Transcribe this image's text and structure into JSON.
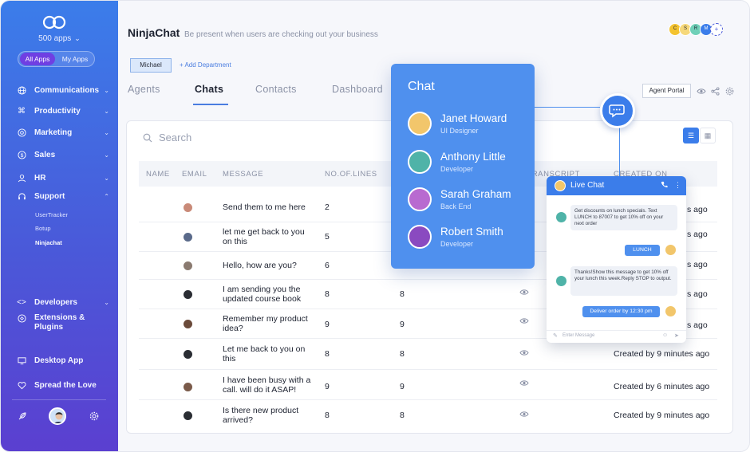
{
  "sidebar": {
    "apps_count": "500 apps",
    "pills": {
      "all": "All Apps",
      "mine": "My Apps"
    },
    "nav": [
      {
        "label": "Communications",
        "icon": "globe-icon"
      },
      {
        "label": "Productivity",
        "icon": "command-icon"
      },
      {
        "label": "Marketing",
        "icon": "megaphone-icon"
      },
      {
        "label": "Sales",
        "icon": "dollar-icon"
      },
      {
        "label": "HR",
        "icon": "person-icon"
      },
      {
        "label": "Support",
        "icon": "headset-icon"
      }
    ],
    "support_sub": [
      "UserTracker",
      "Botup",
      "Ninjachat"
    ],
    "nav2": [
      {
        "label": "Developers",
        "icon": "code-icon"
      },
      {
        "label": "Extensions & Plugins",
        "icon": "puzzle-icon"
      },
      {
        "label": "Desktop App",
        "icon": "monitor-icon"
      },
      {
        "label": "Spread the Love",
        "icon": "heart-icon"
      }
    ]
  },
  "header": {
    "title": "NinjaChat",
    "subtitle": "Be present when users are checking out your business",
    "team_initials": [
      "C",
      "S",
      "R",
      "M"
    ],
    "team_colors": [
      "#f4c32f",
      "#f6d87a",
      "#6fd0b8",
      "#3b7dea"
    ]
  },
  "department": {
    "current": "Michael",
    "add_label": "+ Add Department"
  },
  "tabs": [
    "Agents",
    "Chats",
    "Contacts",
    "Dashboard"
  ],
  "active_tab": "Chats",
  "toolbar": {
    "agent_portal": "Agent Portal"
  },
  "search": {
    "placeholder": "Search"
  },
  "table": {
    "columns": [
      "NAME",
      "EMAIL",
      "MESSAGE",
      "NO.OF.LINES",
      "T TRANSCRIPT",
      "CREATED ON"
    ],
    "rows": [
      {
        "message": "Send them to me here",
        "lines": "2",
        "count": "",
        "created": "",
        "avatar": "#c98a78"
      },
      {
        "message": "let me get back to you on this",
        "lines": "5",
        "count": "",
        "created": "",
        "avatar": "#5a6a8a"
      },
      {
        "message": "Hello, how are you?",
        "lines": "6",
        "count": "",
        "created": "",
        "avatar": "#8a7a70"
      },
      {
        "message": "I am sending you the updated course book",
        "lines": "8",
        "count": "8",
        "created": "",
        "avatar": "#2a2d33"
      },
      {
        "message": "Remember my product idea?",
        "lines": "9",
        "count": "9",
        "created": "",
        "avatar": "#6a4a3a"
      },
      {
        "message": "Let me back to you on this",
        "lines": "8",
        "count": "8",
        "created": "Created by 9 minutes ago",
        "avatar": "#2a2d33"
      },
      {
        "message": "I have been busy with a call. will do it ASAP!",
        "lines": "9",
        "count": "9",
        "created": "Created by 6 minutes ago",
        "avatar": "#7a5a4a"
      },
      {
        "message": "Is there new product arrived?",
        "lines": "8",
        "count": "8",
        "created": "Created by 9 minutes ago",
        "avatar": "#2a2d33"
      }
    ],
    "partial_created": [
      "s ago",
      "s ago",
      "s ago",
      "s ago",
      "s ago"
    ]
  },
  "chat_panel": {
    "title": "Chat",
    "people": [
      {
        "name": "Janet Howard",
        "role": "UI Designer",
        "color": "#f2c66b"
      },
      {
        "name": "Anthony Little",
        "role": "Developer",
        "color": "#4fb3a8"
      },
      {
        "name": "Sarah Graham",
        "role": "Back End",
        "color": "#b86ad0"
      },
      {
        "name": "Robert Smith",
        "role": "Developer",
        "color": "#8a4ac0"
      }
    ]
  },
  "live_chat": {
    "title": "Live Chat",
    "msg1": "Get discounts on lunch specials. Text LUNCH to 87007 to get 10% off on your next order",
    "reply1": "LUNCH",
    "msg2": "Thanks!Show this message to get 10% off your lunch this week.Reply STOP to output.",
    "reply2": "Deliver order by 12:30 pm",
    "input_placeholder": "Enter Message"
  }
}
